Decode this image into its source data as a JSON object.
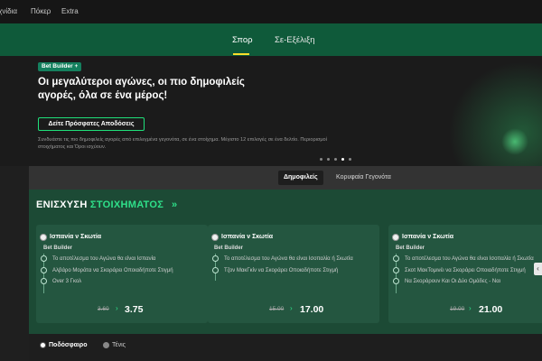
{
  "topbar": {
    "links": [
      "Παιχνίδια",
      "Πόκερ",
      "Extra"
    ]
  },
  "nav": {
    "tabs": [
      "Σπορ",
      "Σε-Εξέλιξη"
    ]
  },
  "hero": {
    "badge": "Bet Builder +",
    "title": "Οι μεγαλύτεροι αγώνες, οι πιο δημοφιλείς αγορές, όλα σε ένα μέρος!",
    "button": "Δείτε Πρόσφατες Αποδόσεις",
    "description": "Συνδυάστε τις πιο δημοφιλείς αγορές από επιλεγμένα γεγονότα, σε ένα στοίχημα. Μέγιστο 12 επιλογές σε ένα δελτίο. Περιορισμοί στοιχήματος και Όροι ισχύουν."
  },
  "filters": [
    "Δημοφιλείς",
    "Κορυφαία Γεγονότα"
  ],
  "section": {
    "title_part1": "ΕΝΙΣΧΥΣΗ ",
    "title_part2": "ΣΤΟΙΧΗΜΑΤΟΣ",
    "arrow": "»"
  },
  "cards": [
    {
      "match": "Ισπανία ν Σκωτία",
      "type": "Bet Builder",
      "selections": [
        "Το αποτέλεσμα του Αγώνα θα είναι Ισπανία",
        "Αλβάρο Μοράτα να Σκοράρει Οποιαδήποτε Στιγμή",
        "Over 3 Γκολ"
      ],
      "old_odds": "3.60",
      "new_odds": "3.75"
    },
    {
      "match": "Ισπανία ν Σκωτία",
      "type": "Bet Builder",
      "selections": [
        "Το αποτέλεσμα του Αγώνα θα είναι Ισοπαλία ή Σκωτία",
        "Τζον ΜακΓκίν να Σκοράρει Οποιαδήποτε Στιγμή"
      ],
      "old_odds": "15.00",
      "new_odds": "17.00"
    },
    {
      "match": "Ισπανία ν Σκωτία",
      "type": "Bet Builder",
      "selections": [
        "Το αποτέλεσμα του Αγώνα θα είναι Ισοπαλία ή Σκωτία",
        "Σκοτ ΜακΤομινέι να Σκοράρει Οποιαδήποτε Στιγμή",
        "Να Σκοράρουν Και Οι Δύο Ομάδες - Ναι"
      ],
      "old_odds": "19.00",
      "new_odds": "21.00"
    }
  ],
  "sports": [
    "Ποδόσφαιρο",
    "Τένις"
  ],
  "colors": {
    "brand_green": "#0f5a3a",
    "accent": "#2fe08a",
    "tab_underline": "#ffde2b"
  }
}
